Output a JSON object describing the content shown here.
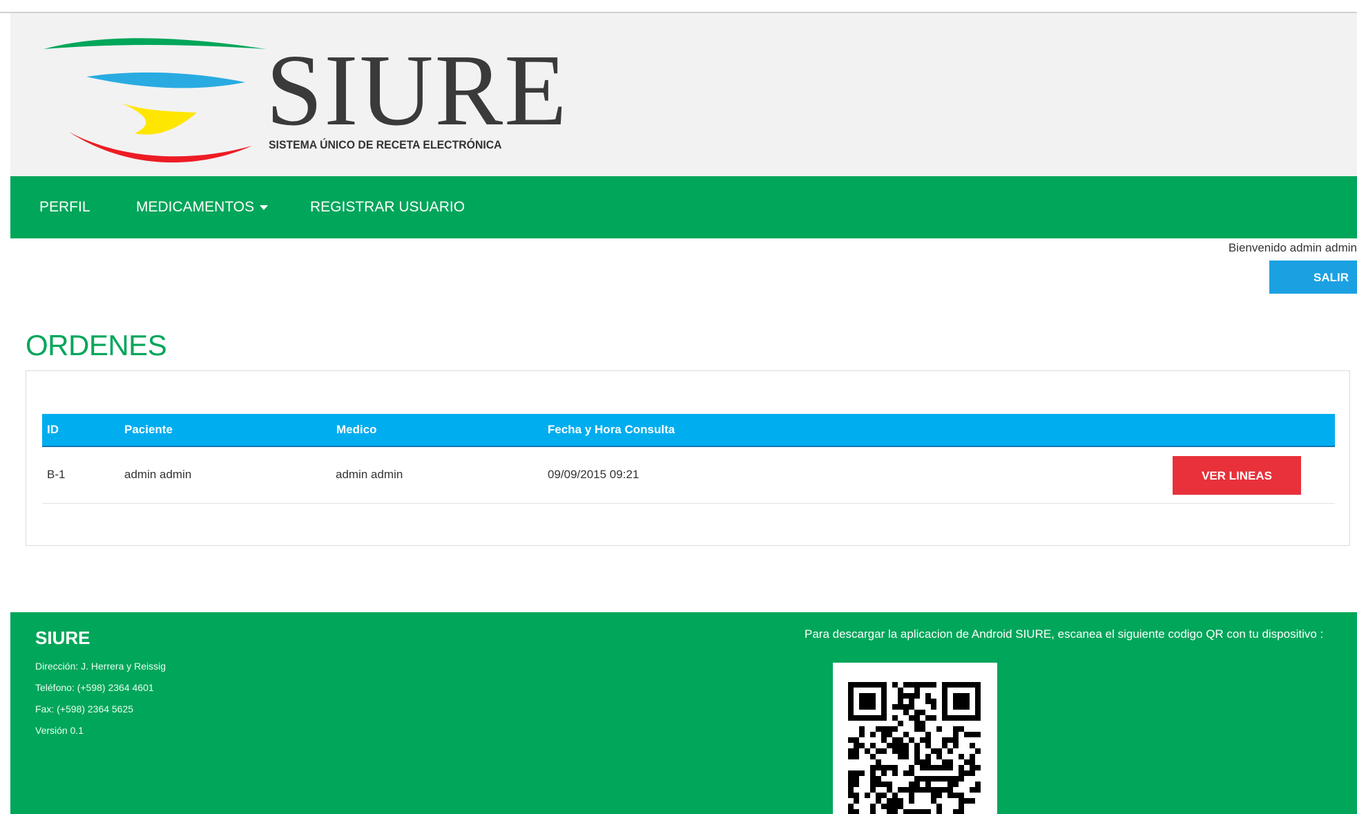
{
  "header": {
    "logo_title": "SIURE",
    "logo_subtitle": "SISTEMA ÚNICO DE RECETA ELECTRÓNICA"
  },
  "nav": {
    "items": [
      {
        "label": "PERFIL"
      },
      {
        "label": "MEDICAMENTOS"
      },
      {
        "label": "REGISTRAR USUARIO"
      }
    ]
  },
  "user": {
    "welcome": "Bienvenido admin admin",
    "logout_label": "SALIR"
  },
  "main": {
    "title": "ORDENES",
    "table": {
      "columns": [
        "ID",
        "Paciente",
        "Medico",
        "Fecha y Hora Consulta"
      ],
      "rows": [
        {
          "id": "B-1",
          "paciente": "admin admin",
          "medico": "admin admin",
          "fecha": "09/09/2015 09:21",
          "action_label": "VER LINEAS"
        }
      ]
    }
  },
  "footer": {
    "title": "SIURE",
    "lines": [
      "Dirección: J. Herrera y Reissig",
      "Teléfono: (+598) 2364 4601",
      "Fax: (+598) 2364 5625",
      "Versión 0.1"
    ],
    "qr_text": "Para descargar la aplicacion de Android SIURE, escanea el siguiente codigo QR con tu dispositivo :"
  },
  "colors": {
    "brand_green": "#00a65a",
    "table_blue": "#00adef",
    "salir_blue": "#1ba1e2",
    "danger_red": "#e8313a"
  }
}
